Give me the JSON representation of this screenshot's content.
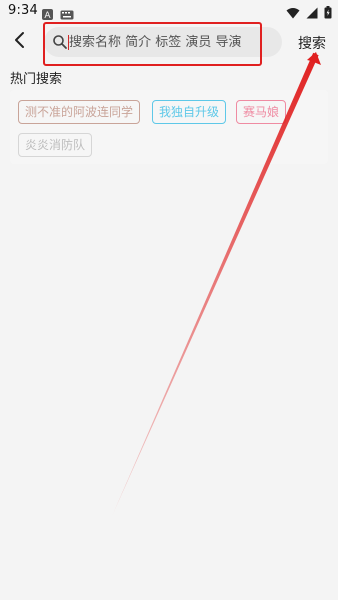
{
  "status_bar": {
    "time": "9:34"
  },
  "header": {
    "search_placeholder": "搜索名称 简介 标签 演员 导演",
    "search_button_label": "搜索"
  },
  "hot_search": {
    "title": "热门搜索",
    "tags": [
      {
        "label": "测不准的阿波连同学",
        "color": "#c9a499"
      },
      {
        "label": "我独自升级",
        "color": "#5ec8e8"
      },
      {
        "label": "赛马娘",
        "color": "#ef8ba2"
      },
      {
        "label": "炎炎消防队",
        "color": "#bdbdbd"
      }
    ]
  },
  "colors": {
    "annotation": "#e02020"
  }
}
